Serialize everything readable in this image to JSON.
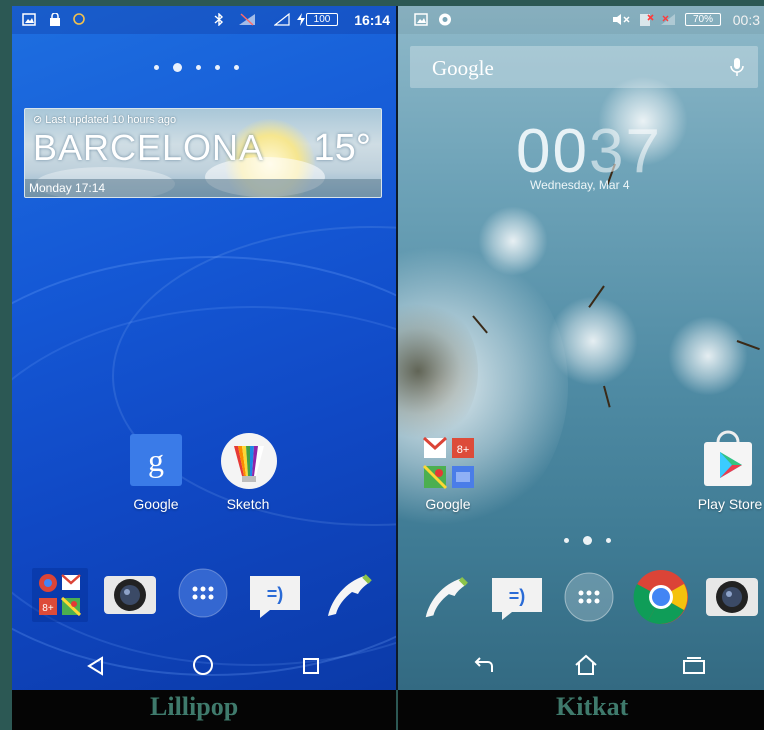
{
  "left": {
    "status": {
      "time": "16:14",
      "battery": "100"
    },
    "weather": {
      "updated": "Last updated 10 hours ago",
      "city": "BARCELONA",
      "temperature": "15°",
      "day_time": "Monday 17:14"
    },
    "apps": [
      {
        "label": "Google",
        "icon": "google-search-icon"
      },
      {
        "label": "Sketch",
        "icon": "sketch-icon"
      }
    ],
    "dock": [
      "google-apps-folder-icon",
      "camera-icon",
      "app-drawer-icon",
      "messaging-icon",
      "phone-icon"
    ],
    "nav": [
      "back-icon",
      "home-icon",
      "recents-icon"
    ],
    "caption": "Lillipop",
    "accent": "#1559d6"
  },
  "right": {
    "status": {
      "time": "00:3",
      "battery": "70%"
    },
    "search": {
      "brand": "Google"
    },
    "clock": {
      "hours": "00",
      "minutes": "37"
    },
    "date": "Wednesday, Mar 4",
    "apps": [
      {
        "label": "Google",
        "icon": "google-apps-folder-icon"
      },
      {
        "label": "Play Store",
        "icon": "play-store-icon"
      }
    ],
    "dock": [
      "phone-icon",
      "messaging-icon",
      "app-drawer-icon",
      "chrome-icon",
      "camera-icon"
    ],
    "nav": [
      "back-icon",
      "home-icon",
      "recents-icon"
    ],
    "caption": "Kitkat",
    "accent": "#4f8ba4"
  }
}
